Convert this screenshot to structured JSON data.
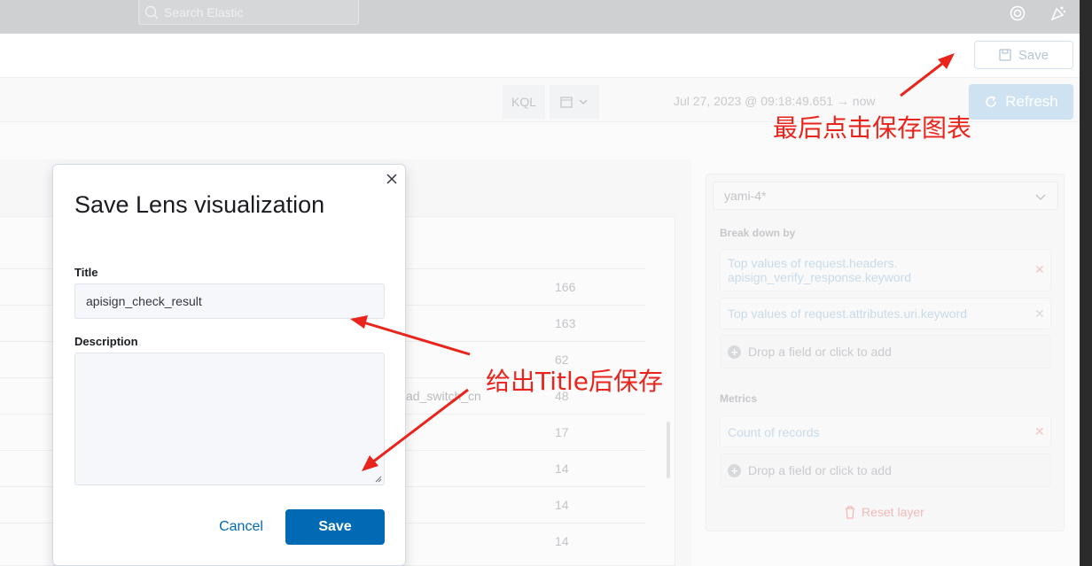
{
  "topbar": {
    "search_placeholder": "Search Elastic"
  },
  "header": {
    "save_label": "Save"
  },
  "query": {
    "kql_label": "KQL",
    "date_range": "Jul 27, 2023 @ 09:18:49.651 → now",
    "refresh_label": "Refresh"
  },
  "table": {
    "rows": [
      {
        "label": "",
        "value": "166"
      },
      {
        "label": "",
        "value": "163"
      },
      {
        "label": "",
        "value": "62"
      },
      {
        "label": "ad_switch_cn",
        "value": "48"
      },
      {
        "label": "",
        "value": "17"
      },
      {
        "label": "",
        "value": "14"
      },
      {
        "label": "",
        "value": "14"
      },
      {
        "label": "",
        "value": "14"
      }
    ]
  },
  "config": {
    "datasource": "yami-4*",
    "breakdown_label": "Break down by",
    "breakdown_items": [
      "Top values of request.headers.\napisign_verify_response.keyword",
      "Top values of request.attributes.uri.keyword"
    ],
    "drop_label": "Drop a field or click to add",
    "metrics_label": "Metrics",
    "metric_item": "Count of records",
    "reset_label": "Reset layer"
  },
  "modal": {
    "title": "Save Lens visualization",
    "title_label": "Title",
    "title_value": "apisign_check_result",
    "description_label": "Description",
    "cancel_label": "Cancel",
    "save_label": "Save"
  },
  "annotations": {
    "top_note": "最后点击保存图表",
    "modal_note": "给出Title后保存",
    "color": "#e8241c"
  }
}
